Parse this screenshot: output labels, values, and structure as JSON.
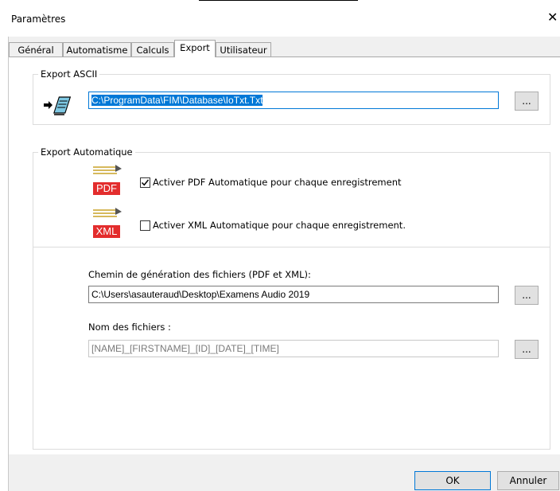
{
  "window": {
    "title": "Paramètres",
    "close_glyph": "✕"
  },
  "tabs": [
    {
      "label": "Général"
    },
    {
      "label": "Automatisme"
    },
    {
      "label": "Calculs"
    },
    {
      "label": "Export"
    },
    {
      "label": "Utilisateur"
    }
  ],
  "active_tab": "Export",
  "export_ascii": {
    "label": "Export ASCII",
    "path": "C:\\ProgramData\\FIM\\Database\\IoTxt.Txt",
    "browse_label": "...",
    "icon": "export-ascii-icon"
  },
  "export_auto": {
    "label": "Export Automatique",
    "pdf_badge": "PDF",
    "pdf_label": "Activer PDF Automatique pour chaque enregistrement",
    "pdf_checked": true,
    "xml_badge": "XML",
    "xml_label": "Activer XML Automatique pour chaque enregistrement.",
    "xml_checked": false,
    "path_label": "Chemin de génération des fichiers (PDF et XML):",
    "path_value": "C:\\Users\\asauteraud\\Desktop\\Examens Audio 2019",
    "path_browse_label": "...",
    "names_label": "Nom des fichiers :",
    "names_value": "[NAME]_[FIRSTNAME]_[ID]_[DATE]_[TIME]",
    "names_browse_label": "..."
  },
  "footer": {
    "ok_label": "OK",
    "cancel_label": "Annuler"
  },
  "colors": {
    "accent": "#0078d7",
    "badge_red": "#e32d2d",
    "panel_bg": "#ffffff",
    "dialog_bg": "#f0f0f0"
  }
}
